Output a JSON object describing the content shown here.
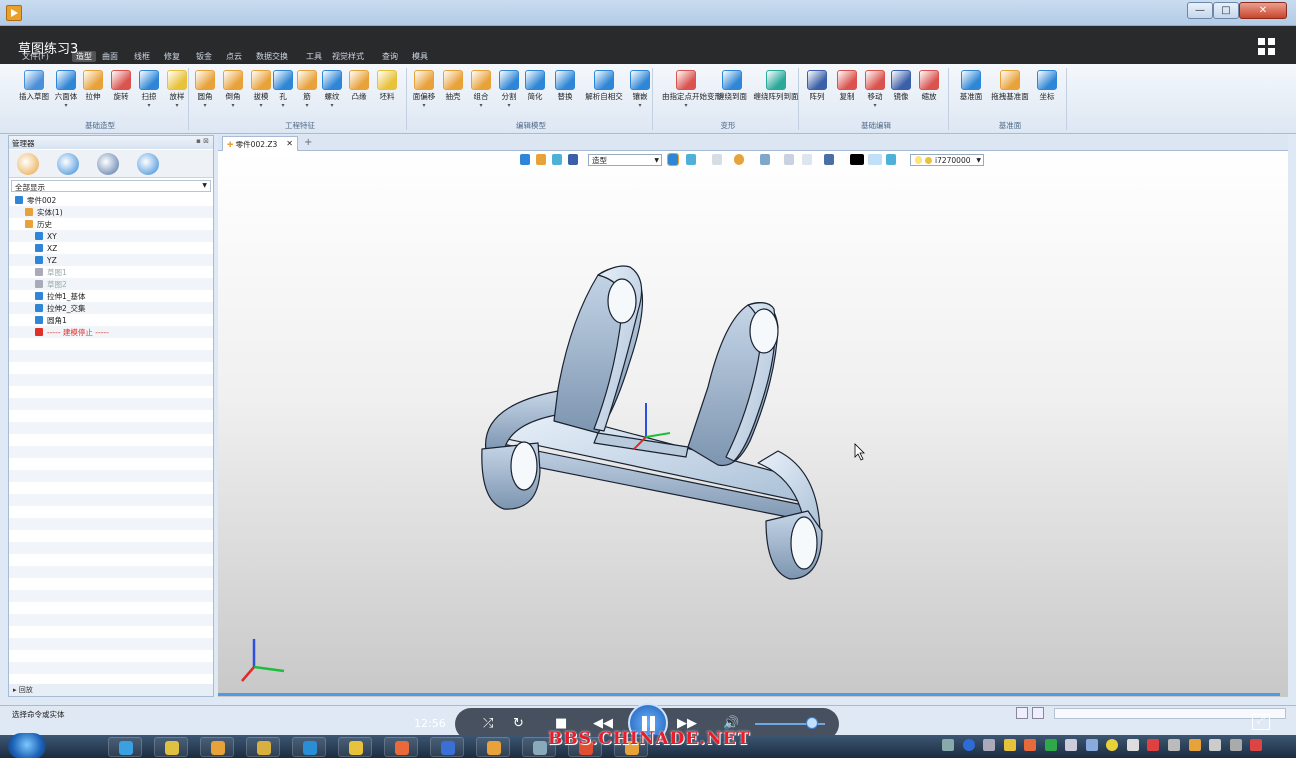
{
  "window": {
    "overlay_title": "草图练习3",
    "minimize_glyph": "—",
    "maximize_glyph": "□",
    "close_glyph": "✕"
  },
  "ribbon_tabs": [
    "文件(F)",
    "造型",
    "曲面",
    "线框",
    "修复",
    "钣金",
    "点云",
    "数据交换",
    "工具",
    "视觉样式",
    "查询",
    "模具"
  ],
  "ribbon": {
    "buttons": [
      {
        "label": "插入草图",
        "icon": "sketch-icon",
        "color": "#4a90d9",
        "dropdown": false
      },
      {
        "label": "六面体",
        "icon": "box-icon",
        "color": "#2f86d6",
        "dropdown": true
      },
      {
        "label": "拉伸",
        "icon": "extrude-icon",
        "color": "#e8a23a",
        "dropdown": false
      },
      {
        "label": "旋转",
        "icon": "revolve-icon",
        "color": "#d9534f",
        "dropdown": false
      },
      {
        "label": "扫掠",
        "icon": "sweep-icon",
        "color": "#2f86d6",
        "dropdown": true
      },
      {
        "label": "放样",
        "icon": "loft-icon",
        "color": "#e8c23a",
        "dropdown": true
      },
      {
        "label": "圆角",
        "icon": "fillet-icon",
        "color": "#e8a23a",
        "dropdown": true
      },
      {
        "label": "倒角",
        "icon": "chamfer-icon",
        "color": "#e8a23a",
        "dropdown": true
      },
      {
        "label": "拔模",
        "icon": "draft-icon",
        "color": "#e8a23a",
        "dropdown": true
      },
      {
        "label": "孔",
        "icon": "hole-icon",
        "color": "#2f86d6",
        "dropdown": true
      },
      {
        "label": "筋",
        "icon": "rib-icon",
        "color": "#e8a23a",
        "dropdown": true
      },
      {
        "label": "螺纹",
        "icon": "thread-icon",
        "color": "#2f86d6",
        "dropdown": true
      },
      {
        "label": "凸缘",
        "icon": "lip-icon",
        "color": "#e8a23a",
        "dropdown": false
      },
      {
        "label": "坯料",
        "icon": "stock-icon",
        "color": "#e8c23a",
        "dropdown": false
      },
      {
        "label": "面偏移",
        "icon": "offset-face-icon",
        "color": "#e8a23a",
        "dropdown": true
      },
      {
        "label": "抽壳",
        "icon": "shell-icon",
        "color": "#e8a23a",
        "dropdown": false
      },
      {
        "label": "组合",
        "icon": "combine-icon",
        "color": "#e8a23a",
        "dropdown": true
      },
      {
        "label": "分割",
        "icon": "split-icon",
        "color": "#2f86d6",
        "dropdown": true
      },
      {
        "label": "简化",
        "icon": "simplify-icon",
        "color": "#2f86d6",
        "dropdown": false
      },
      {
        "label": "替换",
        "icon": "replace-icon",
        "color": "#2f86d6",
        "dropdown": false
      },
      {
        "label": "解析自相交",
        "icon": "self-intersect-icon",
        "color": "#2f86d6",
        "dropdown": false
      },
      {
        "label": "镶嵌",
        "icon": "emboss-icon",
        "color": "#2f86d6",
        "dropdown": true
      },
      {
        "label": "由指定点开始变形",
        "icon": "deform-point-icon",
        "color": "#d9534f",
        "dropdown": true
      },
      {
        "label": "缠绕到面",
        "icon": "wrap-face-icon",
        "color": "#2f86d6",
        "dropdown": false
      },
      {
        "label": "缠绕阵列到面",
        "icon": "wrap-pattern-icon",
        "color": "#2aa89a",
        "dropdown": false
      },
      {
        "label": "阵列",
        "icon": "pattern-icon",
        "color": "#3b5fa8",
        "dropdown": false
      },
      {
        "label": "复制",
        "icon": "copy-icon",
        "color": "#d9534f",
        "dropdown": false
      },
      {
        "label": "移动",
        "icon": "move-icon",
        "color": "#d9534f",
        "dropdown": true
      },
      {
        "label": "镜像",
        "icon": "mirror-icon",
        "color": "#3b5fa8",
        "dropdown": false
      },
      {
        "label": "缩放",
        "icon": "scale-icon",
        "color": "#d9534f",
        "dropdown": false
      },
      {
        "label": "基准面",
        "icon": "datum-plane-icon",
        "color": "#2f86d6",
        "dropdown": false
      },
      {
        "label": "拖拽基准面",
        "icon": "drag-plane-icon",
        "color": "#e8a23a",
        "dropdown": false
      },
      {
        "label": "坐标",
        "icon": "coordinate-icon",
        "color": "#2f86d6",
        "dropdown": false
      }
    ],
    "groups": [
      "基础造型",
      "工程特征",
      "编辑模型",
      "变形",
      "基础编辑",
      "基准面"
    ]
  },
  "manager": {
    "title": "管理器",
    "tabs": [
      {
        "icon": "history-tab-icon",
        "color": "#e8a23a"
      },
      {
        "icon": "user-tab-icon",
        "color": "#2f86d6"
      },
      {
        "icon": "view-tab-icon",
        "color": "#4a6fa5"
      },
      {
        "icon": "feature-tab-icon",
        "color": "#2f86d6"
      }
    ],
    "filter": "全部显示",
    "tree": [
      {
        "label": "零件002",
        "indent": 0,
        "style": "normal",
        "color": "#2f86d6"
      },
      {
        "label": "实体(1)",
        "indent": 1,
        "style": "normal",
        "color": "#e8a23a"
      },
      {
        "label": "历史",
        "indent": 1,
        "style": "normal",
        "color": "#e8a23a"
      },
      {
        "label": "XY",
        "indent": 2,
        "style": "normal",
        "color": "#2f86d6"
      },
      {
        "label": "XZ",
        "indent": 2,
        "style": "normal",
        "color": "#2f86d6"
      },
      {
        "label": "YZ",
        "indent": 2,
        "style": "normal",
        "color": "#2f86d6"
      },
      {
        "label": "草图1",
        "indent": 2,
        "style": "grey",
        "color": "#aab"
      },
      {
        "label": "草图2",
        "indent": 2,
        "style": "grey",
        "color": "#aab"
      },
      {
        "label": "拉伸1_基体",
        "indent": 2,
        "style": "normal",
        "color": "#2f86d6"
      },
      {
        "label": "拉伸2_交集",
        "indent": 2,
        "style": "normal",
        "color": "#2f86d6"
      },
      {
        "label": "圆角1",
        "indent": 2,
        "style": "normal",
        "color": "#2f86d6"
      },
      {
        "label": "----- 建模停止 -----",
        "indent": 2,
        "style": "red",
        "color": "#e0302a"
      }
    ],
    "footer": "▸ 回放"
  },
  "document": {
    "tab_label": "零件002.Z3",
    "close": "✕",
    "add": "+"
  },
  "view_toolbar": {
    "mode": "造型",
    "color_value": "i7270000"
  },
  "status": {
    "text": "选择命令或实体"
  },
  "player": {
    "time": "12:56",
    "volume_fraction": 0.82
  },
  "taskbar": {
    "watermark": "BBS.CHINADE.NET",
    "pinned": [
      "ie-icon",
      "explorer-icon",
      "qq-icon",
      "folder-icon",
      "browser-icon",
      "app-s-icon",
      "app-o-icon",
      "tool-icon",
      "app-i-icon",
      "doc-icon",
      "app-g-icon",
      "player-icon"
    ]
  }
}
